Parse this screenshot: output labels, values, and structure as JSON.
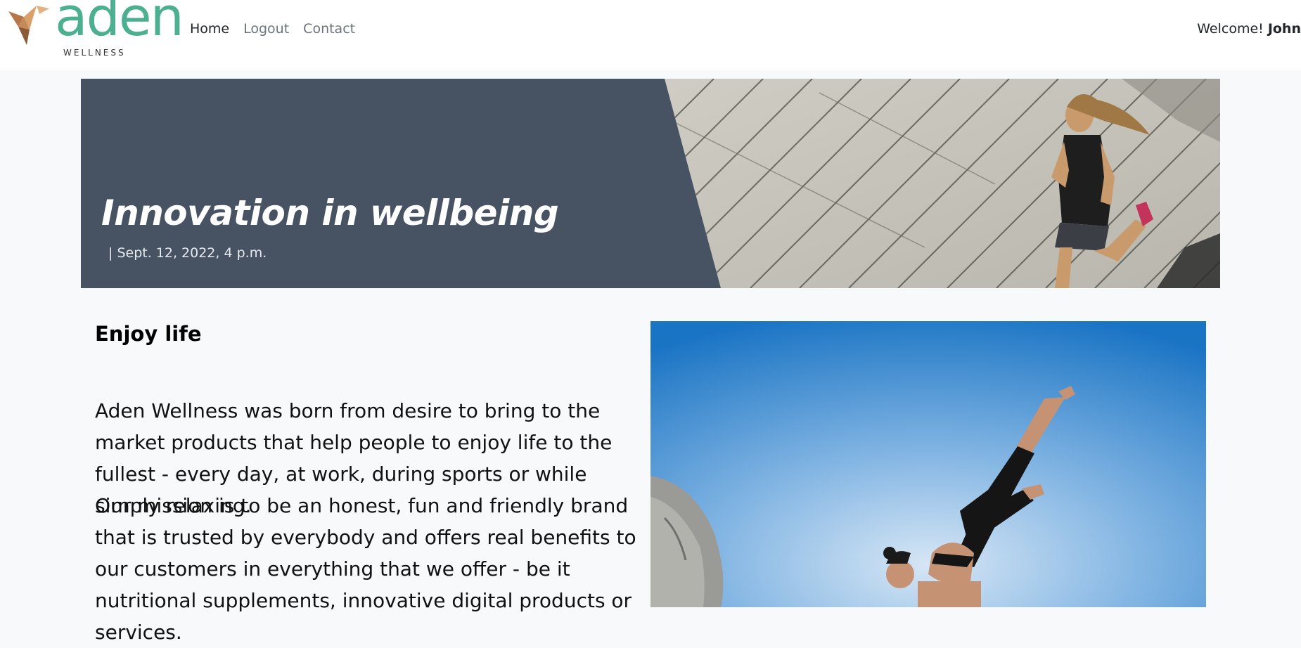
{
  "brand": {
    "logo_text": "aden",
    "logo_subtext": "WELLNESS",
    "colors": {
      "accent": "#4caf8f",
      "mark": "#c08a5a",
      "hero_bg": "#475262"
    }
  },
  "nav": {
    "links": [
      {
        "label": "Home",
        "active": true
      },
      {
        "label": "Logout",
        "active": false
      },
      {
        "label": "Contact",
        "active": false
      }
    ],
    "welcome_prefix": "Welcome!",
    "user_name": "John"
  },
  "hero": {
    "title": "Innovation in wellbeing",
    "date": "| Sept. 12, 2022, 4 p.m.",
    "image_icon": "runner-photo"
  },
  "article": {
    "heading": "Enjoy life",
    "paragraphs": [
      "Aden Wellness was born from desire to bring to the market products that help people to enjoy life to the fullest - every day, at work, during sports or while simply relaxing.",
      "Our mission is to be an honest, fun and friendly brand that is trusted by everybody and offers real benefits to our customers in everything that we offer - be it nutritional supplements, innovative digital products or services."
    ],
    "image_icon": "yoga-photo"
  }
}
